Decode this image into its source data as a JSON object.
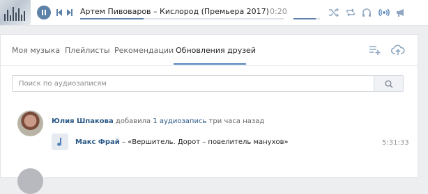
{
  "player": {
    "track": "Артем Пивоваров – Кислород (Премьера 2017)",
    "time": "0:20",
    "progress_fraction": 0.31,
    "volume_fraction": 0.85,
    "accent": "#5e81a8",
    "icons": [
      "pause-icon",
      "prev-icon",
      "next-icon",
      "shuffle-icon",
      "repeat-icon",
      "headphones-icon",
      "broadcast-icon",
      "megaphone-icon"
    ]
  },
  "tabs": [
    "Моя музыка",
    "Плейлисты",
    "Рекомендации",
    "Обновления друзей"
  ],
  "active_tab": 3,
  "toolbar_icons": [
    "add-playlist-icon",
    "upload-icon"
  ],
  "search": {
    "placeholder": "Поиск по аудиозаписям"
  },
  "feed": [
    {
      "user": "Юлия Шпакова",
      "action": "добавила",
      "count_text": "1 аудиозапись",
      "when": "три часа назад",
      "audio": {
        "artist": "Макс Фрай",
        "title": "«Вершитель. Дорот – повелитель манухов»",
        "duration": "5:31:33"
      }
    }
  ],
  "colors": {
    "link": "#2a5885",
    "tab_underline": "#5181b8",
    "background": "#edeef0"
  }
}
